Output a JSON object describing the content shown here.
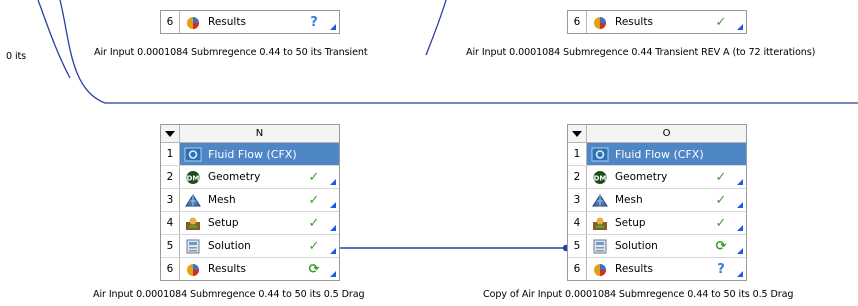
{
  "left_edge_text": "0 its",
  "top_left_block": {
    "row": {
      "num": "6",
      "label": "Results",
      "status": "?"
    },
    "caption": "Air Input 0.0001084 Submregence 0.44 to 50 its Transient"
  },
  "top_right_block": {
    "row": {
      "num": "6",
      "label": "Results",
      "status": "✓"
    },
    "caption": "Air Input 0.0001084 Submregence 0.44 Transient REV A (to 72 itterations)"
  },
  "systems": [
    {
      "id": "N",
      "title": "Fluid Flow (CFX)",
      "caption": "Air Input 0.0001084 Submregence 0.44 to 50 its 0.5 Drag",
      "rows": [
        {
          "num": "2",
          "label": "Geometry",
          "icon": "geometry-dm-icon",
          "status": "✓"
        },
        {
          "num": "3",
          "label": "Mesh",
          "icon": "mesh-icon",
          "status": "✓"
        },
        {
          "num": "4",
          "label": "Setup",
          "icon": "setup-icon",
          "status": "✓"
        },
        {
          "num": "5",
          "label": "Solution",
          "icon": "solution-icon",
          "status": "✓"
        },
        {
          "num": "6",
          "label": "Results",
          "icon": "results-icon",
          "status": "⟳"
        }
      ]
    },
    {
      "id": "O",
      "title": "Fluid Flow (CFX)",
      "caption": "Copy of Air Input 0.0001084 Submregence 0.44 to 50 its 0.5 Drag",
      "rows": [
        {
          "num": "2",
          "label": "Geometry",
          "icon": "geometry-dm-icon",
          "status": "✓"
        },
        {
          "num": "3",
          "label": "Mesh",
          "icon": "mesh-icon",
          "status": "✓"
        },
        {
          "num": "4",
          "label": "Setup",
          "icon": "setup-icon",
          "status": "✓"
        },
        {
          "num": "5",
          "label": "Solution",
          "icon": "solution-icon",
          "status": "⟳"
        },
        {
          "num": "6",
          "label": "Results",
          "icon": "results-icon",
          "status": "?"
        }
      ]
    }
  ],
  "colors": {
    "header_blue": "#4f86c6",
    "link_line": "#2b3f9e",
    "ok_green": "#3f9e2f"
  }
}
